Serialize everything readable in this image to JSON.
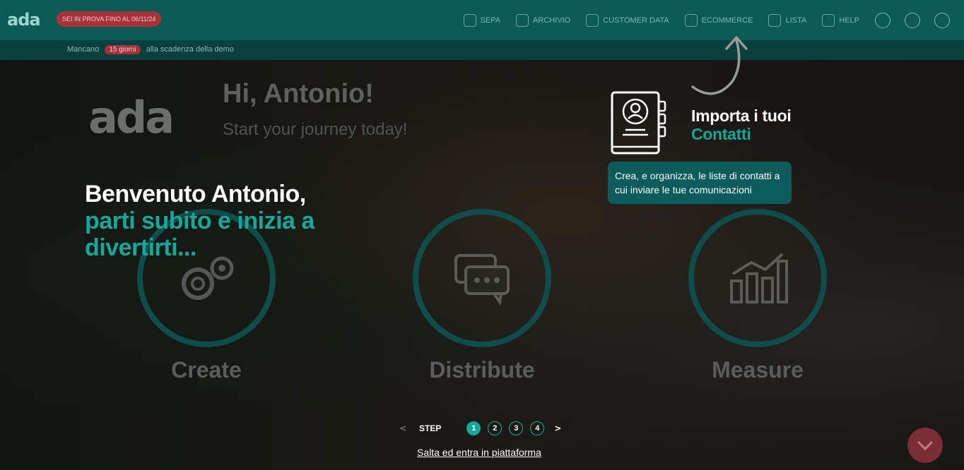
{
  "app": {
    "logo": "ada",
    "trial_badge": "SEI IN PROVA FINO AL 06/11/24"
  },
  "nav": {
    "items": [
      {
        "label": "SEPA",
        "icon": "shield-check-icon"
      },
      {
        "label": "ARCHIVIO",
        "icon": "archive-icon"
      },
      {
        "label": "CUSTOMER DATA",
        "icon": "customer-data-icon"
      },
      {
        "label": "ECOMMERCE",
        "icon": "cart-icon"
      },
      {
        "label": "LISTA",
        "icon": "list-icon"
      },
      {
        "label": "HELP",
        "icon": "help-icon"
      }
    ],
    "right_icons": [
      "smiley-icon",
      "bell-icon",
      "user-icon"
    ]
  },
  "subbar": {
    "prefix": "Mancano",
    "badge": "15 giorni",
    "suffix": "alla scadenza della demo"
  },
  "background": {
    "logo": "ada",
    "greeting": "Hi, Antonio!",
    "tagline": "Start your journey today!",
    "features": [
      {
        "label": "Create",
        "icon": "gears-icon"
      },
      {
        "label": "Distribute",
        "icon": "chat-bubbles-icon"
      },
      {
        "label": "Measure",
        "icon": "bar-chart-icon"
      }
    ]
  },
  "tour": {
    "welcome_line1": "Benvenuto Antonio,",
    "welcome_line2": "parti subito e inizia a divertirti...",
    "step_title_line1": "Importa i tuoi",
    "step_title_line2": "Contatti",
    "tooltip": "Crea, e organizza, le liste di contatti a cui inviare le tue comunicazioni",
    "step_label": "STEP",
    "steps": [
      "1",
      "2",
      "3",
      "4"
    ],
    "active_step": 1,
    "prev_symbol": "<",
    "next_symbol": ">",
    "skip_link": "Salta ed entra in piattaforma"
  },
  "colors": {
    "accent": "#16a79b",
    "topbar": "#0b5a55",
    "tooltip_bg": "#0d5c5c",
    "trial": "#a8323a"
  }
}
